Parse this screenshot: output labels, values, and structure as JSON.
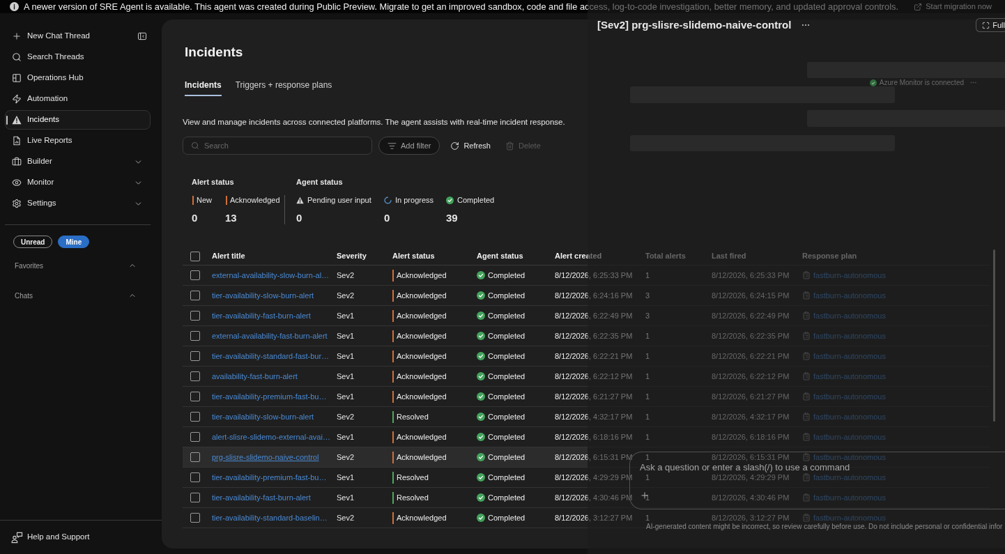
{
  "banner": {
    "message": "A newer version of SRE Agent is available. This agent was created during Public Preview. Migrate to get an improved sandbox, code and file access, log-to-code investigation, better memory, and updated approval controls.",
    "action": "Start migration now"
  },
  "sidebar": {
    "items": [
      {
        "label": "New Chat Thread",
        "selected": false
      },
      {
        "label": "Search Threads",
        "selected": false
      },
      {
        "label": "Operations Hub",
        "selected": false
      },
      {
        "label": "Automation",
        "selected": false
      },
      {
        "label": "Incidents",
        "selected": true
      },
      {
        "label": "Live Reports",
        "selected": false
      },
      {
        "label": "Builder",
        "selected": false,
        "expanded": false
      },
      {
        "label": "Monitor",
        "selected": false,
        "expanded": false
      },
      {
        "label": "Settings",
        "selected": false,
        "expanded": false
      }
    ],
    "filters": [
      {
        "label": "Unread",
        "selected": false
      },
      {
        "label": "Mine",
        "selected": true
      }
    ],
    "sections": [
      {
        "label": "Favorites",
        "expanded": true
      },
      {
        "label": "Chats",
        "expanded": true
      }
    ],
    "footer": "Help and Support"
  },
  "page": {
    "title": "Incidents",
    "tabs": [
      {
        "label": "Incidents",
        "selected": true
      },
      {
        "label": "Triggers + response plans",
        "selected": false
      }
    ],
    "description": "View and manage incidents across connected platforms. The agent assists with real-time incident response.",
    "search": {
      "placeholder": "Search"
    },
    "actions": [
      {
        "label": "Add filter",
        "kind": "outline",
        "disabled": false
      },
      {
        "label": "Refresh",
        "kind": "plain",
        "disabled": false
      },
      {
        "label": "Delete",
        "kind": "plain",
        "disabled": true
      }
    ]
  },
  "stats": {
    "alert_status": {
      "title": "Alert status",
      "items": [
        {
          "label": "New",
          "count": "0",
          "color": "#d0703a"
        },
        {
          "label": "Acknowledged",
          "count": "13",
          "color": "#d0703a"
        }
      ]
    },
    "agent_status": {
      "title": "Agent status",
      "items": [
        {
          "label": "Pending user input",
          "count": "0",
          "kind": "pending"
        },
        {
          "label": "In progress",
          "count": "0",
          "kind": "in_progress"
        },
        {
          "label": "Completed",
          "count": "39",
          "kind": "completed"
        }
      ]
    }
  },
  "table": {
    "select_all": {
      "checked": false
    },
    "columns": [
      "Alert title",
      "Severity",
      "Alert status",
      "Agent status",
      "Alert created",
      "Total alerts",
      "Last fired",
      "Response plan"
    ],
    "rows": [
      {
        "checked": false,
        "selected": false,
        "title": "external-availability-slow-burn-al…",
        "severity": "Sev2",
        "alert_status": {
          "text": "Acknowledged",
          "color": "#d0703a"
        },
        "agent_status": {
          "text": "Completed",
          "kind": "completed"
        },
        "created": "8/12/2026, 6:25:33 PM",
        "total_alerts": "1",
        "last_fired": "8/12/2026, 6:25:33 PM",
        "response_plan": "fastburn-autonomous"
      },
      {
        "checked": false,
        "selected": false,
        "title": "tier-availability-slow-burn-alert",
        "severity": "Sev2",
        "alert_status": {
          "text": "Acknowledged",
          "color": "#d0703a"
        },
        "agent_status": {
          "text": "Completed",
          "kind": "completed"
        },
        "created": "8/12/2026, 6:24:16 PM",
        "total_alerts": "3",
        "last_fired": "8/12/2026, 6:24:15 PM",
        "response_plan": "fastburn-autonomous"
      },
      {
        "checked": false,
        "selected": false,
        "title": "tier-availability-fast-burn-alert",
        "severity": "Sev1",
        "alert_status": {
          "text": "Acknowledged",
          "color": "#d0703a"
        },
        "agent_status": {
          "text": "Completed",
          "kind": "completed"
        },
        "created": "8/12/2026, 6:22:49 PM",
        "total_alerts": "3",
        "last_fired": "8/12/2026, 6:22:49 PM",
        "response_plan": "fastburn-autonomous"
      },
      {
        "checked": false,
        "selected": false,
        "title": "external-availability-fast-burn-alert",
        "severity": "Sev1",
        "alert_status": {
          "text": "Acknowledged",
          "color": "#d0703a"
        },
        "agent_status": {
          "text": "Completed",
          "kind": "completed"
        },
        "created": "8/12/2026, 6:22:35 PM",
        "total_alerts": "1",
        "last_fired": "8/12/2026, 6:22:35 PM",
        "response_plan": "fastburn-autonomous"
      },
      {
        "checked": false,
        "selected": false,
        "title": "tier-availability-standard-fast-bur…",
        "severity": "Sev1",
        "alert_status": {
          "text": "Acknowledged",
          "color": "#d0703a"
        },
        "agent_status": {
          "text": "Completed",
          "kind": "completed"
        },
        "created": "8/12/2026, 6:22:21 PM",
        "total_alerts": "1",
        "last_fired": "8/12/2026, 6:22:21 PM",
        "response_plan": "fastburn-autonomous"
      },
      {
        "checked": false,
        "selected": false,
        "title": "availability-fast-burn-alert",
        "severity": "Sev1",
        "alert_status": {
          "text": "Acknowledged",
          "color": "#d0703a"
        },
        "agent_status": {
          "text": "Completed",
          "kind": "completed"
        },
        "created": "8/12/2026, 6:22:12 PM",
        "total_alerts": "1",
        "last_fired": "8/12/2026, 6:22:12 PM",
        "response_plan": "fastburn-autonomous"
      },
      {
        "checked": false,
        "selected": false,
        "title": "tier-availability-premium-fast-bu…",
        "severity": "Sev1",
        "alert_status": {
          "text": "Acknowledged",
          "color": "#d0703a"
        },
        "agent_status": {
          "text": "Completed",
          "kind": "completed"
        },
        "created": "8/12/2026, 6:21:27 PM",
        "total_alerts": "1",
        "last_fired": "8/12/2026, 6:21:27 PM",
        "response_plan": "fastburn-autonomous"
      },
      {
        "checked": false,
        "selected": false,
        "title": "tier-availability-slow-burn-alert",
        "severity": "Sev2",
        "alert_status": {
          "text": "Resolved",
          "color": "#4ea85a"
        },
        "agent_status": {
          "text": "Completed",
          "kind": "completed"
        },
        "created": "8/12/2026, 4:32:17 PM",
        "total_alerts": "1",
        "last_fired": "8/12/2026, 4:32:17 PM",
        "response_plan": "fastburn-autonomous"
      },
      {
        "checked": false,
        "selected": false,
        "title": "alert-slisre-slidemo-external-avai…",
        "severity": "Sev1",
        "alert_status": {
          "text": "Acknowledged",
          "color": "#d0703a"
        },
        "agent_status": {
          "text": "Completed",
          "kind": "completed"
        },
        "created": "8/12/2026, 6:18:16 PM",
        "total_alerts": "1",
        "last_fired": "8/12/2026, 6:18:16 PM",
        "response_plan": "fastburn-autonomous"
      },
      {
        "checked": false,
        "selected": true,
        "title": "prg-slisre-slidemo-naive-control",
        "severity": "Sev2",
        "alert_status": {
          "text": "Acknowledged",
          "color": "#d0703a"
        },
        "agent_status": {
          "text": "Completed",
          "kind": "completed"
        },
        "created": "8/12/2026, 6:15:31 PM",
        "total_alerts": "1",
        "last_fired": "8/12/2026, 6:15:31 PM",
        "response_plan": "fastburn-autonomous"
      },
      {
        "checked": false,
        "selected": false,
        "title": "tier-availability-premium-fast-bu…",
        "severity": "Sev1",
        "alert_status": {
          "text": "Resolved",
          "color": "#4ea85a"
        },
        "agent_status": {
          "text": "Completed",
          "kind": "completed"
        },
        "created": "8/12/2026, 4:29:29 PM",
        "total_alerts": "1",
        "last_fired": "8/12/2026, 4:29:29 PM",
        "response_plan": "fastburn-autonomous"
      },
      {
        "checked": false,
        "selected": false,
        "title": "tier-availability-fast-burn-alert",
        "severity": "Sev1",
        "alert_status": {
          "text": "Resolved",
          "color": "#4ea85a"
        },
        "agent_status": {
          "text": "Completed",
          "kind": "completed"
        },
        "created": "8/12/2026, 4:30:46 PM",
        "total_alerts": "1",
        "last_fired": "8/12/2026, 4:30:46 PM",
        "response_plan": "fastburn-autonomous"
      },
      {
        "checked": false,
        "selected": false,
        "title": "tier-availability-standard-baselin…",
        "severity": "Sev2",
        "alert_status": {
          "text": "Acknowledged",
          "color": "#d0703a"
        },
        "agent_status": {
          "text": "Completed",
          "kind": "completed"
        },
        "created": "8/12/2026, 3:12:27 PM",
        "total_alerts": "1",
        "last_fired": "8/12/2026, 3:12:27 PM",
        "response_plan": "fastburn-autonomous"
      }
    ]
  },
  "panel": {
    "title": "[Sev2] prg-slisre-slidemo-naive-control",
    "full_button": "Full",
    "connection_status": "Azure Monitor is connected",
    "composer": {
      "placeholder": "Ask a question or enter a slash(/) to use a command"
    },
    "disclaimer": "AI-generated content might be incorrect, so review carefully before use. Do not include personal or confidential infor"
  }
}
